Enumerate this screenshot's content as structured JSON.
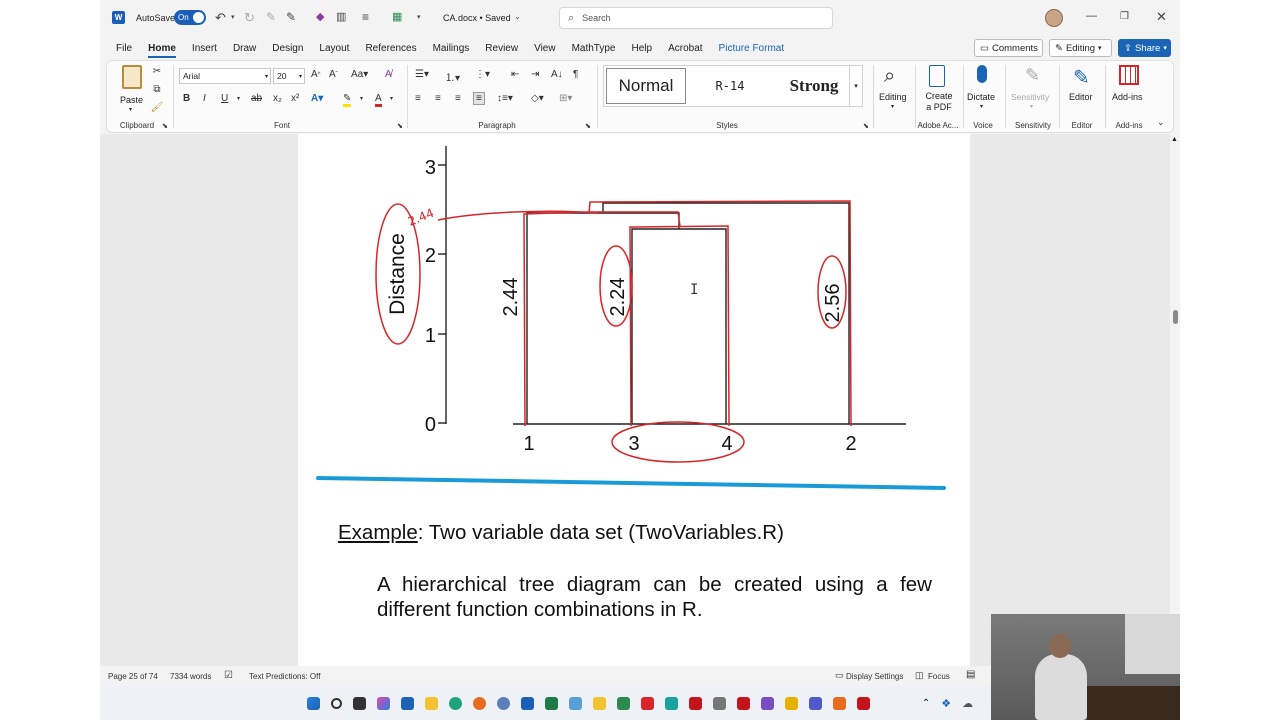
{
  "titlebar": {
    "autosave_label": "AutoSave",
    "autosave_state": "On",
    "doc_title": "CA.docx • Saved",
    "search_placeholder": "Search"
  },
  "tabs": [
    "File",
    "Home",
    "Insert",
    "Draw",
    "Design",
    "Layout",
    "References",
    "Mailings",
    "Review",
    "View",
    "MathType",
    "Help",
    "Acrobat",
    "Picture Format"
  ],
  "header_buttons": {
    "comments": "Comments",
    "editing": "Editing",
    "share": "Share"
  },
  "ribbon": {
    "clipboard": {
      "paste": "Paste",
      "label": "Clipboard"
    },
    "font": {
      "family": "Arial",
      "size": "20",
      "label": "Font"
    },
    "paragraph": {
      "label": "Paragraph"
    },
    "styles": {
      "items": [
        "Normal",
        "R-14",
        "Strong"
      ],
      "label": "Styles"
    },
    "editing": {
      "label": "Editing"
    },
    "adobe": {
      "button": "Create a PDF",
      "label": "Adobe Ac..."
    },
    "voice": {
      "button": "Dictate",
      "label": "Voice"
    },
    "sensitivity": {
      "button": "Sensitivity",
      "label": "Sensitivity"
    },
    "editor": {
      "button": "Editor",
      "label": "Editor"
    },
    "addins": {
      "button": "Add-ins",
      "label": "Add-ins"
    }
  },
  "dendrogram": {
    "y_ticks": [
      "0",
      "1",
      "2",
      "3"
    ],
    "y_label": "Distance",
    "x_labels": [
      "1",
      "3",
      "4",
      "2"
    ],
    "height_labels": [
      "2.44",
      "2.24",
      "2.56"
    ],
    "handwritten_note": "2.44"
  },
  "document": {
    "example_prefix": "Example",
    "example_rest": ": Two variable data set (TwoVariables.R)",
    "paragraph": "A hierarchical tree diagram can be created using a few different function combinations in R."
  },
  "status": {
    "page": "Page 25 of 74",
    "words": "7334 words",
    "text_predictions": "Text Predictions: Off",
    "display_settings": "Display Settings",
    "focus": "Focus"
  },
  "colors": {
    "accent": "#1b63b4",
    "ink": "#d9252a",
    "underline_stroke": "#1a9bd7"
  }
}
